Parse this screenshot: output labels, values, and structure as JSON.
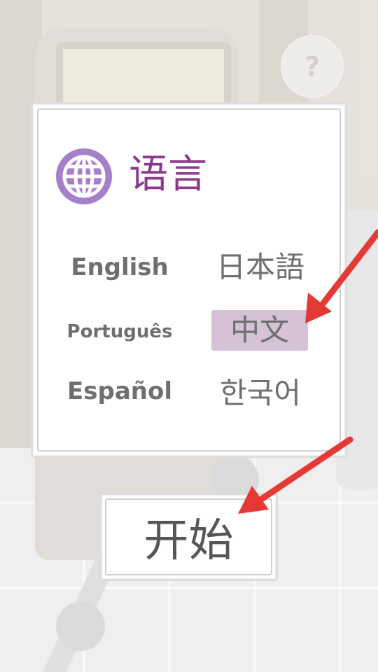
{
  "help": {
    "icon": "question-mark-icon",
    "label": "?"
  },
  "language_panel": {
    "icon": "globe-icon",
    "title": "语言",
    "accent_color": "#8c3a8e",
    "selected": "中文",
    "languages": {
      "english": "English",
      "japanese": "日本語",
      "portuguese": "Português",
      "chinese": "中文",
      "spanish": "Español",
      "korean": "한국어"
    }
  },
  "start_button": {
    "label": "开始"
  },
  "annotations": {
    "arrow_color": "#e53935"
  }
}
